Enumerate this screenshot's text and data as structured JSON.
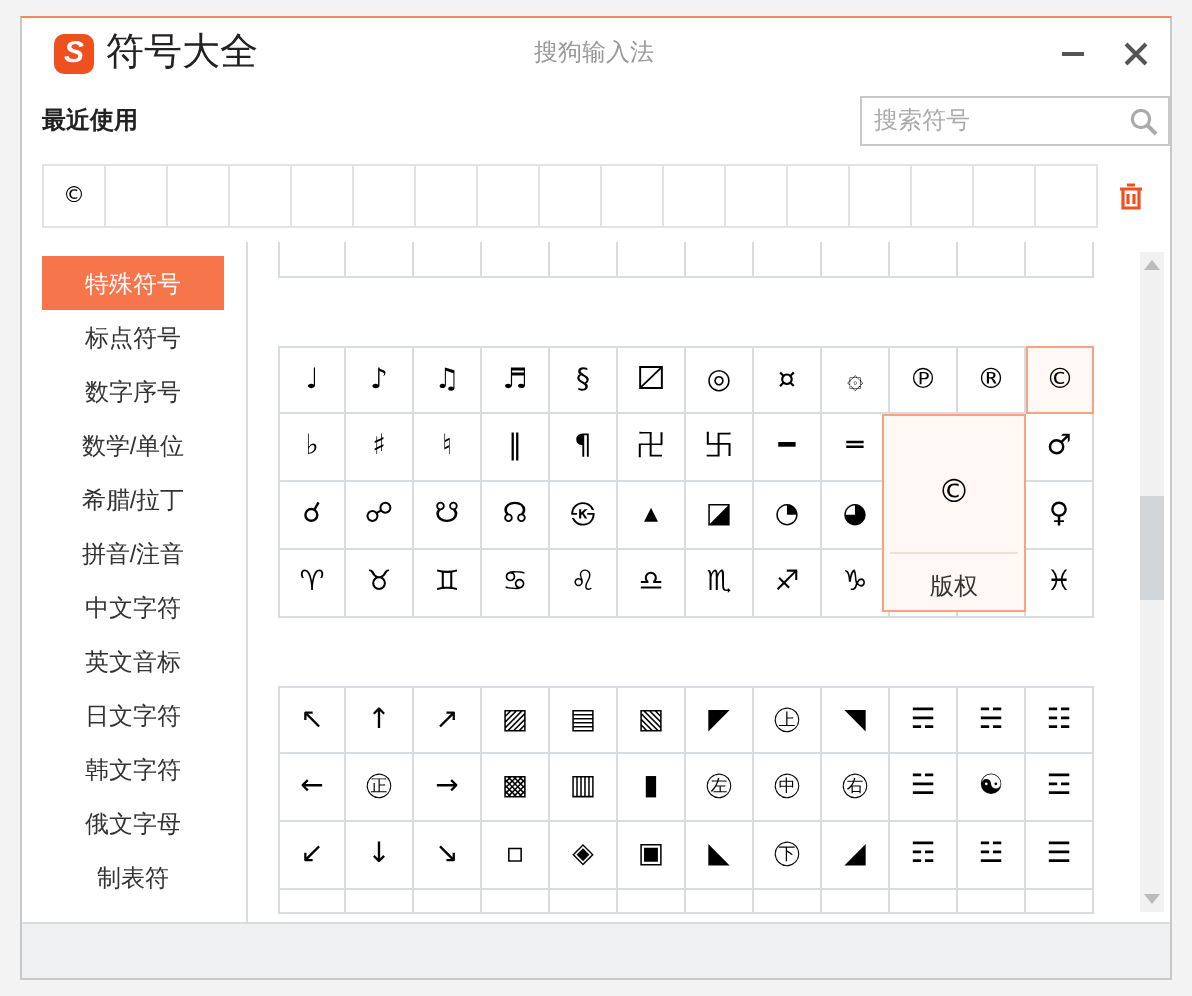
{
  "title_bar": {
    "logo_letter": "S",
    "title": "符号大全",
    "app_name": "搜狗输入法"
  },
  "recent": {
    "label": "最近使用",
    "search": {
      "placeholder": "搜索符号"
    },
    "symbols": [
      "©"
    ]
  },
  "categories": [
    {
      "label": "特殊符号",
      "selected": true
    },
    {
      "label": "标点符号",
      "selected": false
    },
    {
      "label": "数字序号",
      "selected": false
    },
    {
      "label": "数学/单位",
      "selected": false
    },
    {
      "label": "希腊/拉丁",
      "selected": false
    },
    {
      "label": "拼音/注音",
      "selected": false
    },
    {
      "label": "中文字符",
      "selected": false
    },
    {
      "label": "英文音标",
      "selected": false
    },
    {
      "label": "日文字符",
      "selected": false
    },
    {
      "label": "韩文字符",
      "selected": false
    },
    {
      "label": "俄文字母",
      "selected": false
    },
    {
      "label": "制表符",
      "selected": false
    }
  ],
  "symbol_groups": [
    {
      "rows": [
        [
          {
            "symbol": "♩",
            "selected": false
          },
          {
            "symbol": "♪",
            "selected": false
          },
          {
            "symbol": "♫",
            "selected": false
          },
          {
            "symbol": "♬",
            "selected": false
          },
          {
            "symbol": "§",
            "selected": false
          },
          {
            "symbol": "〼",
            "selected": false
          },
          {
            "symbol": "◎",
            "selected": false
          },
          {
            "symbol": "¤",
            "selected": false
          },
          {
            "symbol": "۞",
            "selected": false
          },
          {
            "symbol": "℗",
            "selected": false
          },
          {
            "symbol": "®",
            "selected": false
          },
          {
            "symbol": "©",
            "selected": true
          }
        ],
        [
          {
            "symbol": "♭",
            "selected": false
          },
          {
            "symbol": "♯",
            "selected": false
          },
          {
            "symbol": "♮",
            "selected": false
          },
          {
            "symbol": "‖",
            "selected": false
          },
          {
            "symbol": "¶",
            "selected": false
          },
          {
            "symbol": "卍",
            "selected": false
          },
          {
            "symbol": "卐",
            "selected": false
          },
          {
            "symbol": "━",
            "selected": false
          },
          {
            "symbol": "═",
            "selected": false
          },
          {
            "symbol": "♂",
            "selected": false
          }
        ],
        [
          {
            "symbol": "☌",
            "selected": false
          },
          {
            "symbol": "☍",
            "selected": false
          },
          {
            "symbol": "☋",
            "selected": false
          },
          {
            "symbol": "☊",
            "selected": false
          },
          {
            "symbol": "㉿",
            "selected": false
          },
          {
            "symbol": "▴",
            "selected": false
          },
          {
            "symbol": "◪",
            "selected": false
          },
          {
            "symbol": "◔",
            "selected": false
          },
          {
            "symbol": "◕",
            "selected": false
          },
          {
            "symbol": "♀",
            "selected": false
          }
        ],
        [
          {
            "symbol": "♈",
            "selected": false
          },
          {
            "symbol": "♉",
            "selected": false
          },
          {
            "symbol": "♊",
            "selected": false
          },
          {
            "symbol": "♋",
            "selected": false
          },
          {
            "symbol": "♌",
            "selected": false
          },
          {
            "symbol": "♎",
            "selected": false
          },
          {
            "symbol": "♏",
            "selected": false
          },
          {
            "symbol": "♐",
            "selected": false
          },
          {
            "symbol": "♑",
            "selected": false
          },
          {
            "symbol": "♓",
            "selected": false
          }
        ]
      ]
    },
    {
      "rows": [
        [
          {
            "symbol": "↖",
            "selected": false
          },
          {
            "symbol": "↑",
            "selected": false
          },
          {
            "symbol": "↗",
            "selected": false
          },
          {
            "symbol": "▨",
            "selected": false
          },
          {
            "symbol": "▤",
            "selected": false
          },
          {
            "symbol": "▧",
            "selected": false
          },
          {
            "symbol": "◤",
            "selected": false
          },
          {
            "symbol": "㊤",
            "selected": false
          },
          {
            "symbol": "◥",
            "selected": false
          },
          {
            "symbol": "☴",
            "selected": false
          },
          {
            "symbol": "☵",
            "selected": false
          },
          {
            "symbol": "☷",
            "selected": false
          }
        ],
        [
          {
            "symbol": "←",
            "selected": false
          },
          {
            "symbol": "㊣",
            "selected": false
          },
          {
            "symbol": "→",
            "selected": false
          },
          {
            "symbol": "▩",
            "selected": false
          },
          {
            "symbol": "▥",
            "selected": false
          },
          {
            "symbol": "▮",
            "selected": false
          },
          {
            "symbol": "㊧",
            "selected": false
          },
          {
            "symbol": "㊥",
            "selected": false
          },
          {
            "symbol": "㊨",
            "selected": false
          },
          {
            "symbol": "☱",
            "selected": false
          },
          {
            "symbol": "☯",
            "selected": false
          },
          {
            "symbol": "☲",
            "selected": false
          }
        ],
        [
          {
            "symbol": "↙",
            "selected": false
          },
          {
            "symbol": "↓",
            "selected": false
          },
          {
            "symbol": "↘",
            "selected": false
          },
          {
            "symbol": "▫",
            "selected": false
          },
          {
            "symbol": "◈",
            "selected": false
          },
          {
            "symbol": "▣",
            "selected": false
          },
          {
            "symbol": "◣",
            "selected": false
          },
          {
            "symbol": "㊦",
            "selected": false
          },
          {
            "symbol": "◢",
            "selected": false
          },
          {
            "symbol": "☶",
            "selected": false
          },
          {
            "symbol": "☳",
            "selected": false
          },
          {
            "symbol": "☰",
            "selected": false
          }
        ]
      ]
    }
  ],
  "preview": {
    "symbol": "©",
    "name": "版权"
  }
}
